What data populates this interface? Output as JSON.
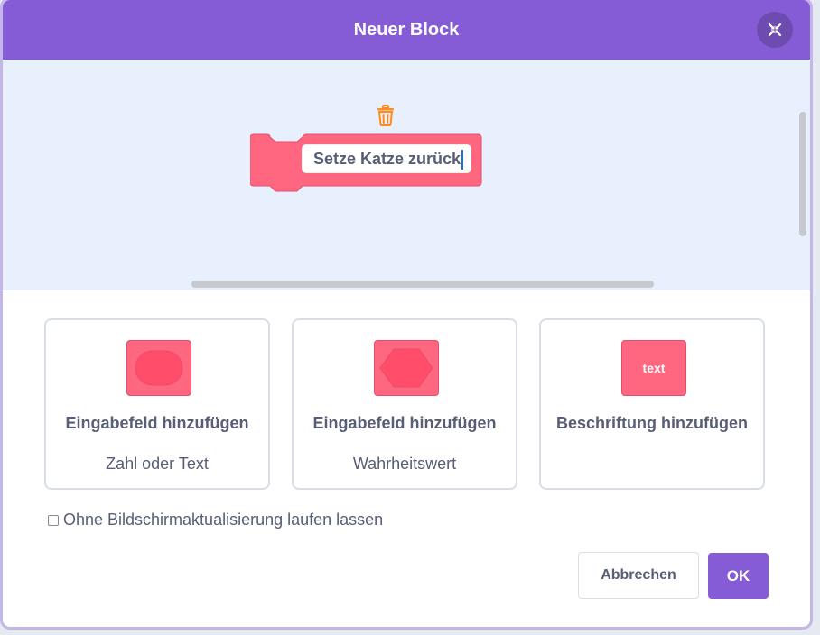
{
  "dialog": {
    "title": "Neuer Block",
    "close_icon": "shrink-arrows-icon"
  },
  "workspace": {
    "block_name": "Setze Katze zurück",
    "block_color": "#ff6680",
    "trash_icon": "trash-icon"
  },
  "options": [
    {
      "title": "Eingabefeld hinzufügen",
      "subtitle": "Zahl oder Text",
      "icon": "rounded-input-icon"
    },
    {
      "title": "Eingabefeld hinzufügen",
      "subtitle": "Wahrheitswert",
      "icon": "hexagon-input-icon"
    },
    {
      "title": "Beschriftung hinzufügen",
      "subtitle": "",
      "icon_text": "text",
      "icon": "text-label-icon"
    }
  ],
  "run_without_refresh": {
    "label": "Ohne Bildschirmaktualisierung laufen lassen",
    "checked": false
  },
  "buttons": {
    "cancel": "Abbrechen",
    "ok": "OK"
  },
  "colors": {
    "header": "#855cd6",
    "workspace_bg": "#e8f0fd",
    "block": "#ff6680",
    "text": "#575e75"
  }
}
